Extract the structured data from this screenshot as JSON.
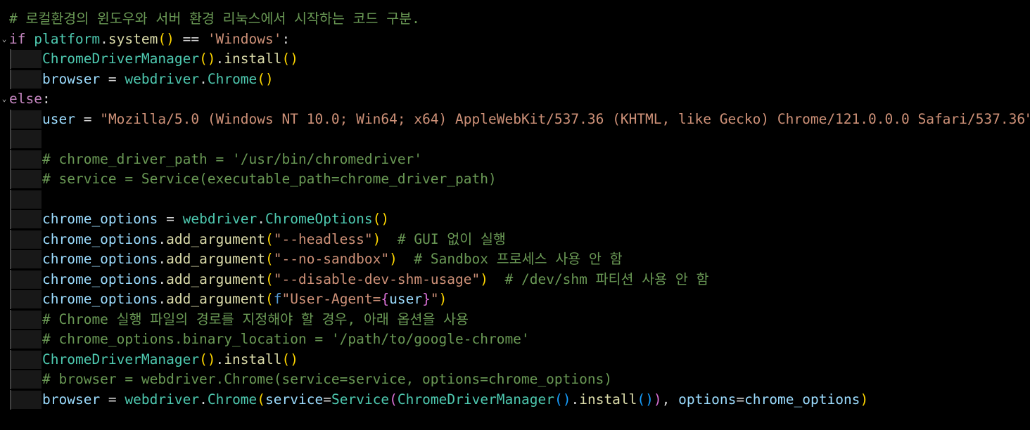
{
  "editor": {
    "lines": [
      {
        "indent": 0,
        "fold": "",
        "tokens": [
          {
            "t": "# 로컬환경의 윈도우와 서버 환경 리눅스에서 시작하는 코드 구분.",
            "c": "#6a9955"
          }
        ]
      },
      {
        "indent": 0,
        "fold": "⌄",
        "tokens": [
          {
            "t": "if",
            "c": "#c586c0"
          },
          {
            "t": " ",
            "c": "#d4d4d4"
          },
          {
            "t": "platform",
            "c": "#4ec9b0"
          },
          {
            "t": ".",
            "c": "#d4d4d4"
          },
          {
            "t": "system",
            "c": "#dcdcaa"
          },
          {
            "t": "()",
            "c": "#ffd700"
          },
          {
            "t": " == ",
            "c": "#d4d4d4"
          },
          {
            "t": "'Windows'",
            "c": "#ce9178"
          },
          {
            "t": ":",
            "c": "#d4d4d4"
          }
        ]
      },
      {
        "indent": 1,
        "fold": "",
        "tokens": [
          {
            "t": "ChromeDriverManager",
            "c": "#4ec9b0"
          },
          {
            "t": "()",
            "c": "#ffd700"
          },
          {
            "t": ".",
            "c": "#d4d4d4"
          },
          {
            "t": "install",
            "c": "#dcdcaa"
          },
          {
            "t": "()",
            "c": "#ffd700"
          }
        ]
      },
      {
        "indent": 1,
        "fold": "",
        "tokens": [
          {
            "t": "browser",
            "c": "#9cdcfe"
          },
          {
            "t": " = ",
            "c": "#d4d4d4"
          },
          {
            "t": "webdriver",
            "c": "#4ec9b0"
          },
          {
            "t": ".",
            "c": "#d4d4d4"
          },
          {
            "t": "Chrome",
            "c": "#4ec9b0"
          },
          {
            "t": "()",
            "c": "#ffd700"
          }
        ]
      },
      {
        "indent": 0,
        "fold": "⌄",
        "tokens": [
          {
            "t": "else",
            "c": "#c586c0"
          },
          {
            "t": ":",
            "c": "#d4d4d4"
          }
        ]
      },
      {
        "indent": 1,
        "fold": "",
        "tokens": [
          {
            "t": "user",
            "c": "#9cdcfe"
          },
          {
            "t": " = ",
            "c": "#d4d4d4"
          },
          {
            "t": "\"Mozilla/5.0 (Windows NT 10.0; Win64; x64) AppleWebKit/537.36 (KHTML, like Gecko) Chrome/121.0.0.0 Safari/537.36\"",
            "c": "#ce9178"
          }
        ]
      },
      {
        "indent": 1,
        "fold": "",
        "tokens": []
      },
      {
        "indent": 1,
        "fold": "",
        "tokens": [
          {
            "t": "# chrome_driver_path = '/usr/bin/chromedriver'",
            "c": "#6a9955"
          }
        ]
      },
      {
        "indent": 1,
        "fold": "",
        "tokens": [
          {
            "t": "# service = Service(executable_path=chrome_driver_path)",
            "c": "#6a9955"
          }
        ]
      },
      {
        "indent": 1,
        "fold": "",
        "tokens": []
      },
      {
        "indent": 1,
        "fold": "",
        "tokens": [
          {
            "t": "chrome_options",
            "c": "#9cdcfe"
          },
          {
            "t": " = ",
            "c": "#d4d4d4"
          },
          {
            "t": "webdriver",
            "c": "#4ec9b0"
          },
          {
            "t": ".",
            "c": "#d4d4d4"
          },
          {
            "t": "ChromeOptions",
            "c": "#4ec9b0"
          },
          {
            "t": "()",
            "c": "#ffd700"
          }
        ]
      },
      {
        "indent": 1,
        "fold": "",
        "tokens": [
          {
            "t": "chrome_options",
            "c": "#9cdcfe"
          },
          {
            "t": ".",
            "c": "#d4d4d4"
          },
          {
            "t": "add_argument",
            "c": "#dcdcaa"
          },
          {
            "t": "(",
            "c": "#ffd700"
          },
          {
            "t": "\"--headless\"",
            "c": "#ce9178"
          },
          {
            "t": ")",
            "c": "#ffd700"
          },
          {
            "t": "  ",
            "c": "#d4d4d4"
          },
          {
            "t": "# GUI 없이 실행",
            "c": "#6a9955"
          }
        ]
      },
      {
        "indent": 1,
        "fold": "",
        "tokens": [
          {
            "t": "chrome_options",
            "c": "#9cdcfe"
          },
          {
            "t": ".",
            "c": "#d4d4d4"
          },
          {
            "t": "add_argument",
            "c": "#dcdcaa"
          },
          {
            "t": "(",
            "c": "#ffd700"
          },
          {
            "t": "\"--no-sandbox\"",
            "c": "#ce9178"
          },
          {
            "t": ")",
            "c": "#ffd700"
          },
          {
            "t": "  ",
            "c": "#d4d4d4"
          },
          {
            "t": "# Sandbox 프로세스 사용 안 함",
            "c": "#6a9955"
          }
        ]
      },
      {
        "indent": 1,
        "fold": "",
        "tokens": [
          {
            "t": "chrome_options",
            "c": "#9cdcfe"
          },
          {
            "t": ".",
            "c": "#d4d4d4"
          },
          {
            "t": "add_argument",
            "c": "#dcdcaa"
          },
          {
            "t": "(",
            "c": "#ffd700"
          },
          {
            "t": "\"--disable-dev-shm-usage\"",
            "c": "#ce9178"
          },
          {
            "t": ")",
            "c": "#ffd700"
          },
          {
            "t": "  ",
            "c": "#d4d4d4"
          },
          {
            "t": "# /dev/shm 파티션 사용 안 함",
            "c": "#6a9955"
          }
        ]
      },
      {
        "indent": 1,
        "fold": "",
        "tokens": [
          {
            "t": "chrome_options",
            "c": "#9cdcfe"
          },
          {
            "t": ".",
            "c": "#d4d4d4"
          },
          {
            "t": "add_argument",
            "c": "#dcdcaa"
          },
          {
            "t": "(",
            "c": "#ffd700"
          },
          {
            "t": "f",
            "c": "#569cd6"
          },
          {
            "t": "\"User-Agent=",
            "c": "#ce9178"
          },
          {
            "t": "{",
            "c": "#da70d6"
          },
          {
            "t": "user",
            "c": "#9cdcfe"
          },
          {
            "t": "}",
            "c": "#da70d6"
          },
          {
            "t": "\"",
            "c": "#ce9178"
          },
          {
            "t": ")",
            "c": "#ffd700"
          }
        ]
      },
      {
        "indent": 1,
        "fold": "",
        "tokens": [
          {
            "t": "# Chrome 실행 파일의 경로를 지정해야 할 경우, 아래 옵션을 사용",
            "c": "#6a9955"
          }
        ]
      },
      {
        "indent": 1,
        "fold": "",
        "tokens": [
          {
            "t": "# chrome_options.binary_location = '/path/to/google-chrome'",
            "c": "#6a9955"
          }
        ]
      },
      {
        "indent": 1,
        "fold": "",
        "tokens": [
          {
            "t": "ChromeDriverManager",
            "c": "#4ec9b0"
          },
          {
            "t": "()",
            "c": "#ffd700"
          },
          {
            "t": ".",
            "c": "#d4d4d4"
          },
          {
            "t": "install",
            "c": "#dcdcaa"
          },
          {
            "t": "()",
            "c": "#ffd700"
          }
        ]
      },
      {
        "indent": 1,
        "fold": "",
        "tokens": [
          {
            "t": "# browser = webdriver.Chrome(service=service, options=chrome_options)",
            "c": "#6a9955"
          }
        ]
      },
      {
        "indent": 1,
        "fold": "",
        "tokens": [
          {
            "t": "browser",
            "c": "#9cdcfe"
          },
          {
            "t": " = ",
            "c": "#d4d4d4"
          },
          {
            "t": "webdriver",
            "c": "#4ec9b0"
          },
          {
            "t": ".",
            "c": "#d4d4d4"
          },
          {
            "t": "Chrome",
            "c": "#4ec9b0"
          },
          {
            "t": "(",
            "c": "#ffd700"
          },
          {
            "t": "service",
            "c": "#9cdcfe"
          },
          {
            "t": "=",
            "c": "#d4d4d4"
          },
          {
            "t": "Service",
            "c": "#4ec9b0"
          },
          {
            "t": "(",
            "c": "#da70d6"
          },
          {
            "t": "ChromeDriverManager",
            "c": "#4ec9b0"
          },
          {
            "t": "()",
            "c": "#179fff"
          },
          {
            "t": ".",
            "c": "#d4d4d4"
          },
          {
            "t": "install",
            "c": "#dcdcaa"
          },
          {
            "t": "()",
            "c": "#179fff"
          },
          {
            "t": ")",
            "c": "#da70d6"
          },
          {
            "t": ", ",
            "c": "#d4d4d4"
          },
          {
            "t": "options",
            "c": "#9cdcfe"
          },
          {
            "t": "=",
            "c": "#d4d4d4"
          },
          {
            "t": "chrome_options",
            "c": "#9cdcfe"
          },
          {
            "t": ")",
            "c": "#ffd700"
          }
        ]
      }
    ]
  }
}
